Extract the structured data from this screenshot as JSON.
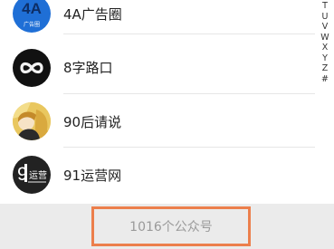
{
  "accounts": [
    {
      "name": "4A广告圈",
      "logo_text": "4A",
      "logo_subtext": "广告圈",
      "icon": "4a-logo-icon"
    },
    {
      "name": "8字路口",
      "logo_text": "∞",
      "icon": "infinity-logo-icon"
    },
    {
      "name": "90后请说",
      "icon": "portrait-avatar-icon"
    },
    {
      "name": "91运营网",
      "logo_text": "9",
      "logo_subtext": "运营",
      "icon": "91-logo-icon"
    }
  ],
  "alphabet_index": [
    "T",
    "U",
    "V",
    "W",
    "X",
    "Y",
    "Z",
    "#"
  ],
  "footer": {
    "count_label": "1016个公众号"
  },
  "colors": {
    "highlight_border": "#ec7f4c",
    "footer_bg": "#ebebeb",
    "logo_blue": "#1f6fd6"
  }
}
